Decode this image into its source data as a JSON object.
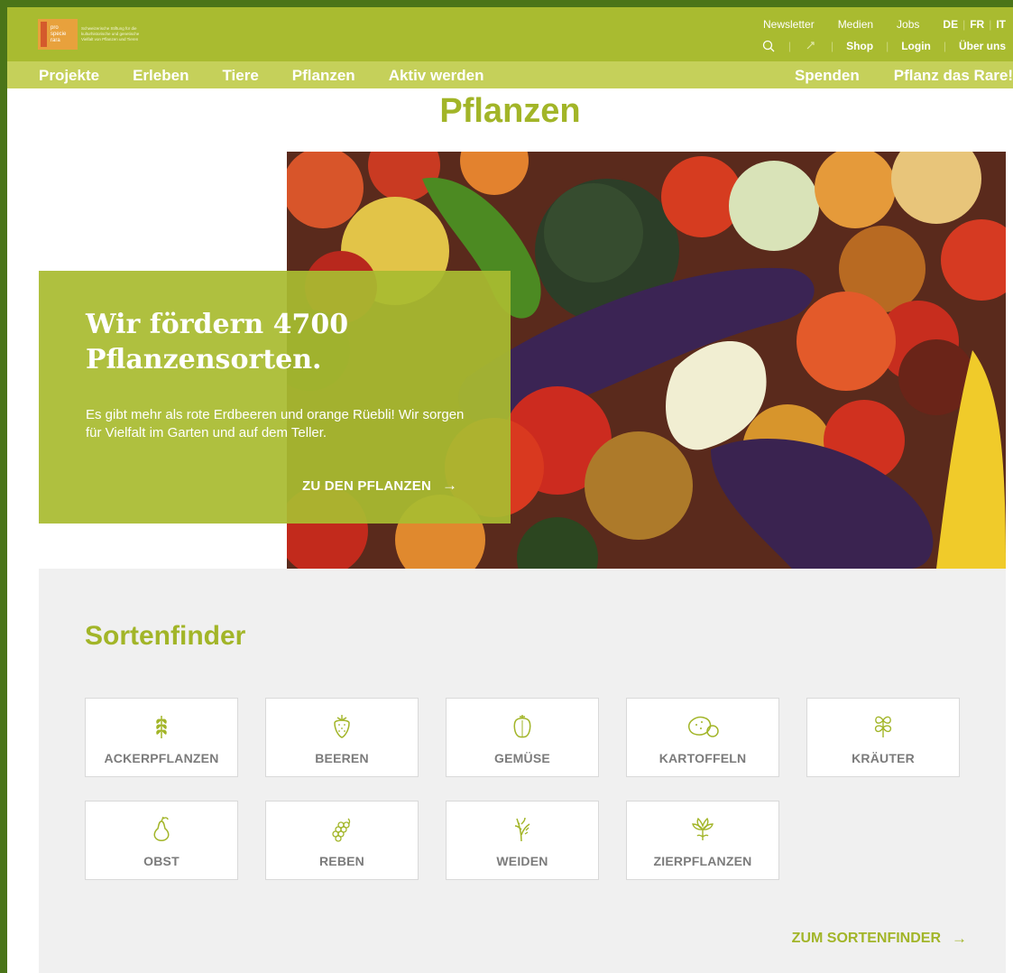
{
  "logo": {
    "lines": [
      "pro",
      "specie",
      "rara"
    ],
    "tagline": "Schweizerische Stiftung für die kulturhistorische und genetische Vielfalt von Pflanzen und Tieren"
  },
  "utility": {
    "newsletter": "Newsletter",
    "medien": "Medien",
    "jobs": "Jobs",
    "languages": [
      "DE",
      "FR",
      "IT"
    ],
    "shop": "Shop",
    "login": "Login",
    "ueber_uns": "Über uns"
  },
  "nav": {
    "items": [
      "Projekte",
      "Erleben",
      "Tiere",
      "Pflanzen",
      "Aktiv werden"
    ],
    "spenden": "Spenden",
    "pflanz": "Pflanz das Rare!"
  },
  "page_title": "Pflanzen",
  "hero": {
    "heading": "Wir fördern 4700 Pflanzensorten.",
    "text": "Es gibt mehr als rote Erdbeeren und orange Rüebli! Wir sorgen für Vielfalt im Garten und auf dem Teller.",
    "cta": "ZU DEN PFLANZEN",
    "arrow": "→"
  },
  "sortenfinder": {
    "title": "Sortenfinder",
    "tiles": [
      {
        "label": "ACKERPFLANZEN",
        "icon": "wheat-icon"
      },
      {
        "label": "BEEREN",
        "icon": "strawberry-icon"
      },
      {
        "label": "GEMÜSE",
        "icon": "pepper-icon"
      },
      {
        "label": "KARTOFFELN",
        "icon": "potato-icon"
      },
      {
        "label": "KRÄUTER",
        "icon": "herb-icon"
      },
      {
        "label": "OBST",
        "icon": "pear-icon"
      },
      {
        "label": "REBEN",
        "icon": "grapes-icon"
      },
      {
        "label": "WEIDEN",
        "icon": "grass-icon"
      },
      {
        "label": "ZIERPFLANZEN",
        "icon": "flower-icon"
      }
    ],
    "cta": "ZUM SORTENFINDER",
    "arrow": "→"
  },
  "colors": {
    "header_green": "#a9bb30",
    "nav_green": "#c5d05a",
    "title_green": "#a2b528",
    "outer_frame": "#4a7418",
    "finder_bg": "#f0f0f0"
  }
}
